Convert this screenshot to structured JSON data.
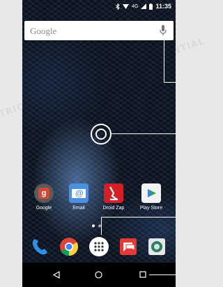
{
  "status_bar": {
    "time": "11:35",
    "network": "4G"
  },
  "search_bar": {
    "logo_text": "Google",
    "mic_icon": "mic-icon"
  },
  "apps": [
    {
      "label": "Google",
      "icon": "google-folder-icon"
    },
    {
      "label": "Email",
      "icon": "email-icon"
    },
    {
      "label": "Droid Zap",
      "icon": "droid-zap-icon"
    },
    {
      "label": "Play Store",
      "icon": "play-store-icon"
    }
  ],
  "dock": [
    {
      "icon": "phone-icon"
    },
    {
      "icon": "chrome-icon"
    },
    {
      "icon": "app-drawer-icon"
    },
    {
      "icon": "messaging-icon"
    },
    {
      "icon": "camera-icon"
    }
  ],
  "nav": {
    "back": "back-icon",
    "home": "home-icon",
    "recents": "recents-icon"
  },
  "watermark": "RESTRICTED :: MOTOROLA CONFIDENTIAL",
  "colors": {
    "wallpaper": "#0b1320",
    "accent_blue": "#3f7de0",
    "zap_red": "#d32027"
  }
}
